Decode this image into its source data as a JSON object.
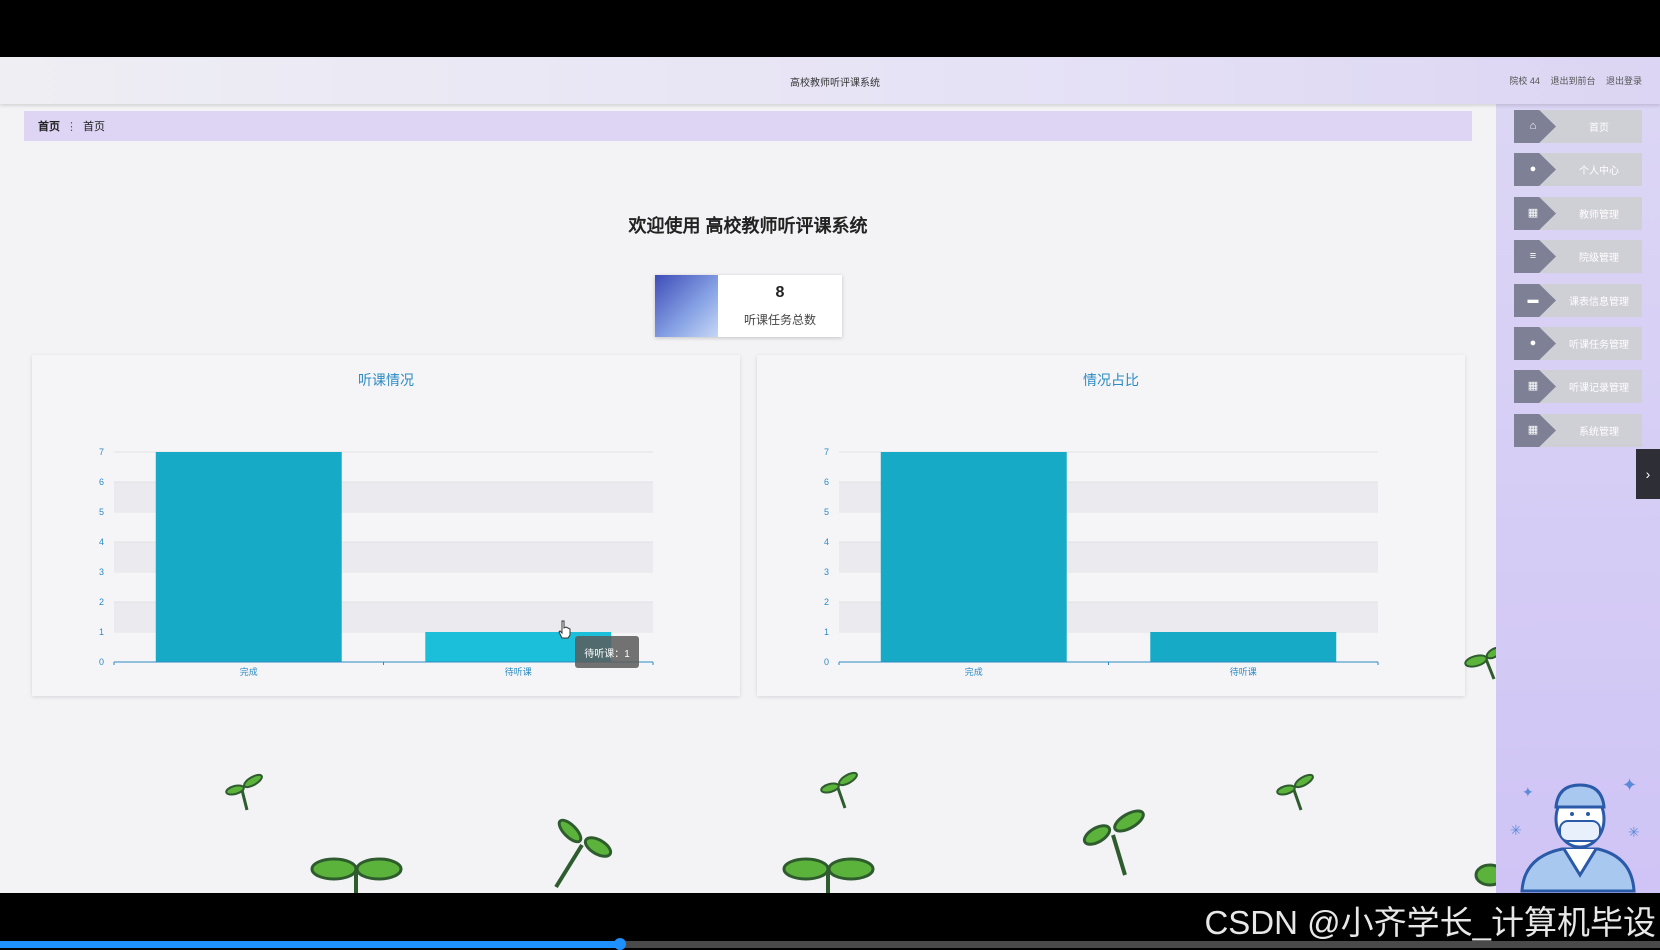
{
  "header": {
    "title": "高校教师听评课系统",
    "user": "院校 44",
    "links": [
      "退出到前台",
      "退出登录"
    ]
  },
  "breadcrumb": {
    "home": "首页",
    "separator": "⋮",
    "current": "首页"
  },
  "welcome": "欢迎使用 高校教师听评课系统",
  "stat": {
    "value": "8",
    "label": "听课任务总数"
  },
  "sidebar": {
    "items": [
      {
        "label": "首页",
        "icon": "home-icon"
      },
      {
        "label": "个人中心",
        "icon": "user-icon"
      },
      {
        "label": "教师管理",
        "icon": "grid-icon"
      },
      {
        "label": "院级管理",
        "icon": "list-icon"
      },
      {
        "label": "课表信息管理",
        "icon": "monitor-icon"
      },
      {
        "label": "听课任务管理",
        "icon": "bulb-icon"
      },
      {
        "label": "听课记录管理",
        "icon": "grid-icon"
      },
      {
        "label": "系统管理",
        "icon": "grid-icon"
      }
    ]
  },
  "tooltip": "待听课：1",
  "watermark": "CSDN @小齐学长_计算机毕设",
  "colors": {
    "bar": "#17aac6",
    "bar_highlight": "#1bbfd9",
    "panel_title": "#2d8bc2",
    "sidebar": "#d5cdf5"
  },
  "chart_data": [
    {
      "type": "bar",
      "title": "听课情况",
      "categories": [
        "完成",
        "待听课"
      ],
      "values": [
        7,
        1
      ],
      "ylim": [
        0,
        7
      ],
      "yticks": [
        0,
        1,
        2,
        3,
        4,
        5,
        6,
        7
      ]
    },
    {
      "type": "bar",
      "title": "情况占比",
      "categories": [
        "完成",
        "待听课"
      ],
      "values": [
        7,
        1
      ],
      "ylim": [
        0,
        7
      ],
      "yticks": [
        0,
        1,
        2,
        3,
        4,
        5,
        6,
        7
      ]
    }
  ]
}
